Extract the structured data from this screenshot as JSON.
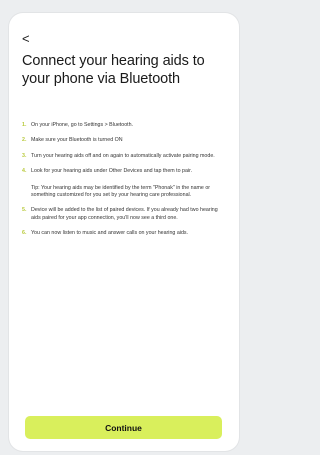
{
  "header": {
    "back_glyph": "<",
    "title": "Connect your hearing aids to your phone via Bluetooth"
  },
  "steps": [
    {
      "num": "1.",
      "text": "On your iPhone, go to Settings > Bluetooth."
    },
    {
      "num": "2.",
      "text": "Make sure your Bluetooth is turned ON"
    },
    {
      "num": "3.",
      "text": "Turn your hearing aids off and on again to automatically activate pairing mode."
    },
    {
      "num": "4.",
      "text": "Look for your hearing aids under Other Devices and tap them to pair.",
      "tip": "Tip: Your hearing aids may be identified by the term \"Phonak\" in the name or something customized for you set by your hearing care professional."
    },
    {
      "num": "5.",
      "text": "Device will be added to the list of paired devices. If you already had two hearing aids paired for your app connection, you'll now see a third one."
    },
    {
      "num": "6.",
      "text": "You can now listen to music and answer calls on your hearing aids."
    }
  ],
  "footer": {
    "continue_label": "Continue"
  },
  "colors": {
    "accent": "#d9ef5c",
    "step_number": "#b8c93a"
  },
  "icons": {
    "back": "chevron-left-icon"
  }
}
